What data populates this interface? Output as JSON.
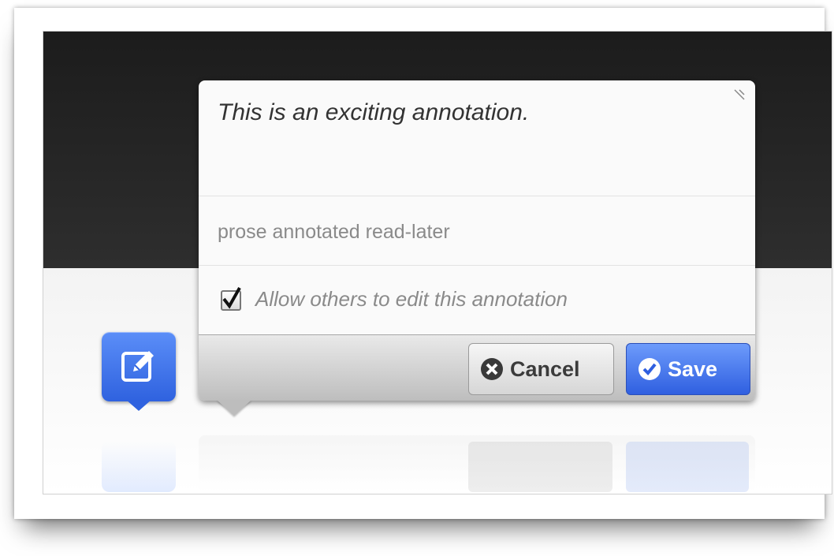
{
  "editor": {
    "annotation_text": "This is an exciting annotation.",
    "tags_text": "prose annotated read-later",
    "allow_edit_checked": true,
    "allow_edit_label": "Allow others to edit this annotation",
    "cancel_label": "Cancel",
    "save_label": "Save"
  },
  "icons": {
    "adder": "edit-icon",
    "cancel": "x-circle-icon",
    "save": "check-circle-icon",
    "resize": "resize-grip-icon"
  },
  "colors": {
    "accent": "#2f62df",
    "header": "#222222"
  }
}
